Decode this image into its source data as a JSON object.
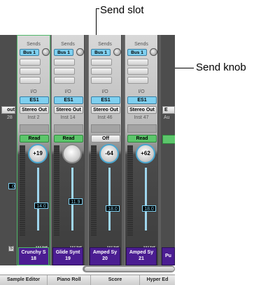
{
  "callouts": {
    "send_slot": "Send slot",
    "send_knob": "Send knob"
  },
  "left_edge": {
    "output_fragment": "out",
    "number_fragment": "28",
    "fader_fragment": "0",
    "ms_fragment": "S"
  },
  "right_edge": {
    "output_fragment": "E",
    "channel_fragment": "Au",
    "plate_fragment": "Pu"
  },
  "channels": [
    {
      "sends_label": "Sends",
      "send": "Bus 1",
      "io_label": "I/O",
      "plugin": "ES1",
      "output": "Stereo Out",
      "inst": "Inst 2",
      "automation": "Read",
      "pan": "+19",
      "fader": "14.0",
      "mute": "M",
      "solo": "S",
      "name": "Crunchy S",
      "number": "18"
    },
    {
      "sends_label": "Sends",
      "send": "Bus 1",
      "io_label": "I/O",
      "plugin": "ES1",
      "output": "Stereo Out",
      "inst": "Inst 14",
      "automation": "Read",
      "pan": "",
      "fader": "11.9",
      "mute": "M",
      "solo": "S",
      "name": "Glide Synt",
      "number": "19"
    },
    {
      "sends_label": "Sends",
      "send": "Bus 1",
      "io_label": "I/O",
      "plugin": "ES1",
      "output": "Stereo Out",
      "inst": "Inst 46",
      "automation": "Off",
      "pan": "-64",
      "fader": "18.0",
      "mute": "M",
      "solo": "S",
      "name": "Amped Sy",
      "number": "20"
    },
    {
      "sends_label": "Sends",
      "send": "Bus 1",
      "io_label": "I/O",
      "plugin": "ES1",
      "output": "Stereo Out",
      "inst": "Inst 47",
      "automation": "Read",
      "pan": "+62",
      "fader": "18.0",
      "mute": "M",
      "solo": "S",
      "name": "Amped Sy",
      "number": "21"
    }
  ],
  "tabs": [
    "Sample Editor",
    "Piano Roll",
    "Score",
    "Hyper Ed"
  ],
  "colors": {
    "send_slot": "#7fd0f0",
    "read": "#5cc66b",
    "name_plate": "#4b1d92",
    "selected_outline": "#4fb86a"
  }
}
